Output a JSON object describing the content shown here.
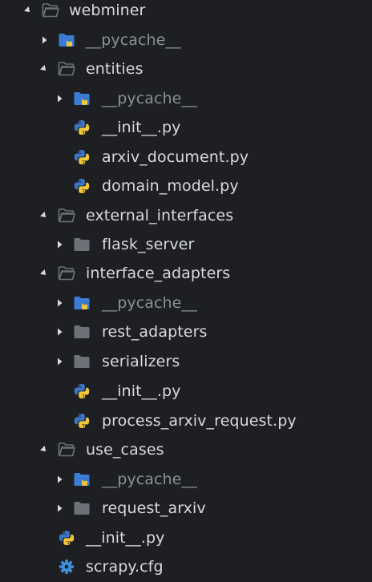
{
  "explorer": {
    "items": [
      {
        "label": "webminer",
        "kind": "folder",
        "state": "open",
        "depth": 0
      },
      {
        "label": "__pycache__",
        "kind": "folder-python",
        "state": "closed",
        "depth": 1,
        "dimmed": true
      },
      {
        "label": "entities",
        "kind": "folder",
        "state": "open",
        "depth": 1
      },
      {
        "label": "__pycache__",
        "kind": "folder-python",
        "state": "closed",
        "depth": 2,
        "dimmed": true
      },
      {
        "label": "__init__.py",
        "kind": "python-file",
        "depth": 2
      },
      {
        "label": "arxiv_document.py",
        "kind": "python-file",
        "depth": 2
      },
      {
        "label": "domain_model.py",
        "kind": "python-file",
        "depth": 2
      },
      {
        "label": "external_interfaces",
        "kind": "folder",
        "state": "open",
        "depth": 1
      },
      {
        "label": "flask_server",
        "kind": "folder",
        "state": "closed",
        "depth": 2
      },
      {
        "label": "interface_adapters",
        "kind": "folder",
        "state": "open",
        "depth": 1
      },
      {
        "label": "__pycache__",
        "kind": "folder-python",
        "state": "closed",
        "depth": 2,
        "dimmed": true
      },
      {
        "label": "rest_adapters",
        "kind": "folder",
        "state": "closed",
        "depth": 2
      },
      {
        "label": "serializers",
        "kind": "folder",
        "state": "closed",
        "depth": 2
      },
      {
        "label": "__init__.py",
        "kind": "python-file",
        "depth": 2
      },
      {
        "label": "process_arxiv_request.py",
        "kind": "python-file",
        "depth": 2
      },
      {
        "label": "use_cases",
        "kind": "folder",
        "state": "open",
        "depth": 1
      },
      {
        "label": "__pycache__",
        "kind": "folder-python",
        "state": "closed",
        "depth": 2,
        "dimmed": true
      },
      {
        "label": "request_arxiv",
        "kind": "folder",
        "state": "closed",
        "depth": 2
      },
      {
        "label": "__init__.py",
        "kind": "python-file",
        "depth": 1
      },
      {
        "label": "scrapy.cfg",
        "kind": "config-file",
        "depth": 1
      }
    ]
  },
  "colors": {
    "background": "#1e1f22",
    "text": "#d8dadf",
    "dimmed_text": "#8b8f97",
    "folder": "#6d7279",
    "python_folder": "#3d7cd6",
    "python_blue": "#3b77c8",
    "python_yellow": "#f2c73b",
    "config_blue": "#3f8fe0"
  }
}
